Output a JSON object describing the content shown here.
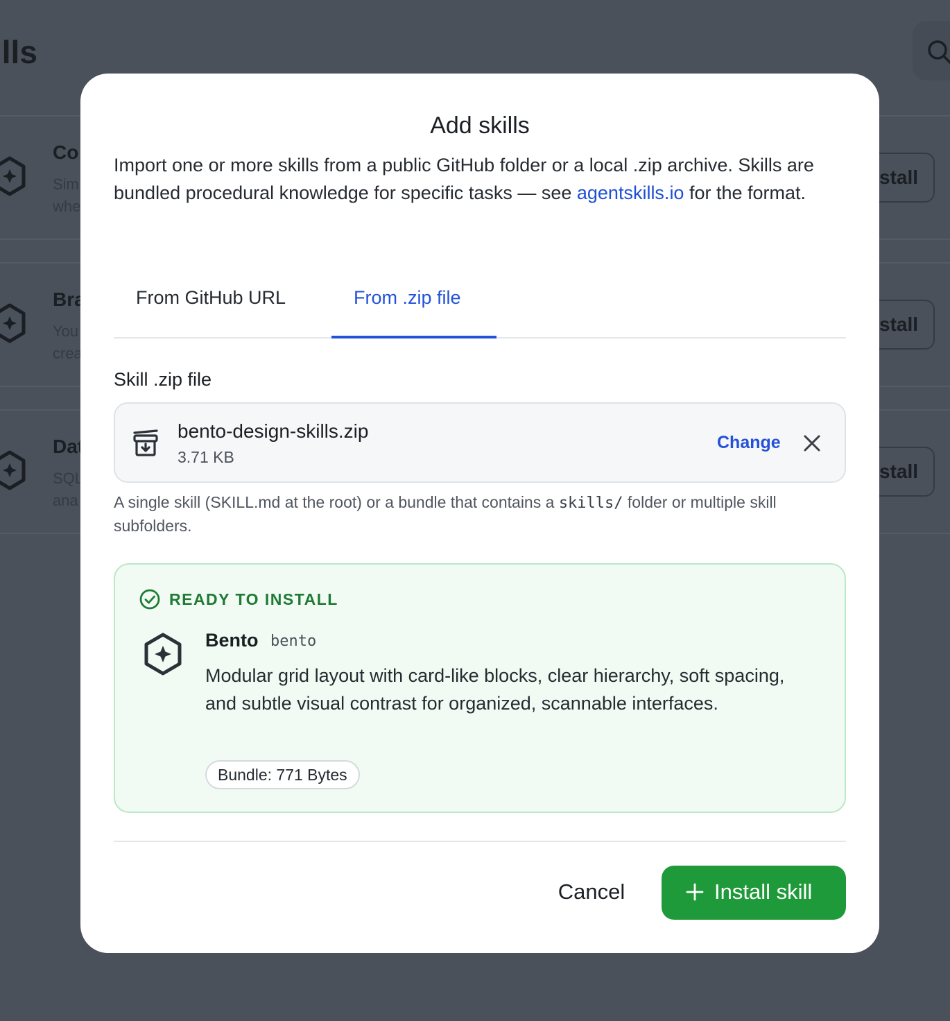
{
  "background": {
    "page_title": "ills",
    "rows": [
      {
        "name": "Co",
        "desc_line1": "Sim",
        "desc_line2": "whe",
        "action": "stall"
      },
      {
        "name": "Bra",
        "desc_line1": "You",
        "desc_line2": "crea",
        "action": "stall"
      },
      {
        "name": "Dat",
        "desc_line1": "SQL",
        "desc_line2": "ana",
        "action": "stall"
      }
    ]
  },
  "modal": {
    "title": "Add skills",
    "description_before": "Import one or more skills from a public GitHub folder or a local .zip archive. Skills are bundled procedural knowledge for specific tasks — see ",
    "description_link": "agentskills.io",
    "description_after": " for the format.",
    "tabs": [
      {
        "label": "From GitHub URL",
        "active": false
      },
      {
        "label": "From .zip file",
        "active": true
      }
    ],
    "field_label": "Skill .zip file",
    "file": {
      "name": "bento-design-skills.zip",
      "size": "3.71 KB",
      "change_label": "Change"
    },
    "hint_before": "A single skill (SKILL.md at the root) or a bundle that contains a ",
    "hint_code": "skills/",
    "hint_after": " folder or multiple skill subfolders.",
    "ready": {
      "label": "READY TO INSTALL",
      "skill_name": "Bento",
      "skill_slug": "bento",
      "skill_description": "Modular grid layout with card-like blocks, clear hierarchy, soft spacing, and subtle visual contrast for organized, scannable interfaces.",
      "bundle_badge": "Bundle: 771 Bytes"
    },
    "cancel_label": "Cancel",
    "install_label": "Install skill"
  },
  "colors": {
    "accent_blue": "#2352d8",
    "success_green": "#1f9a3a",
    "ready_bg": "#f1fbf3",
    "ready_border": "#b9e8c4",
    "overlay": "#4a515b"
  },
  "icons": {
    "search": "search-icon",
    "skill": "hexagon-sparkle-icon",
    "archive": "archive-download-icon",
    "close": "close-icon",
    "check": "check-circle-icon",
    "plus": "plus-icon"
  }
}
